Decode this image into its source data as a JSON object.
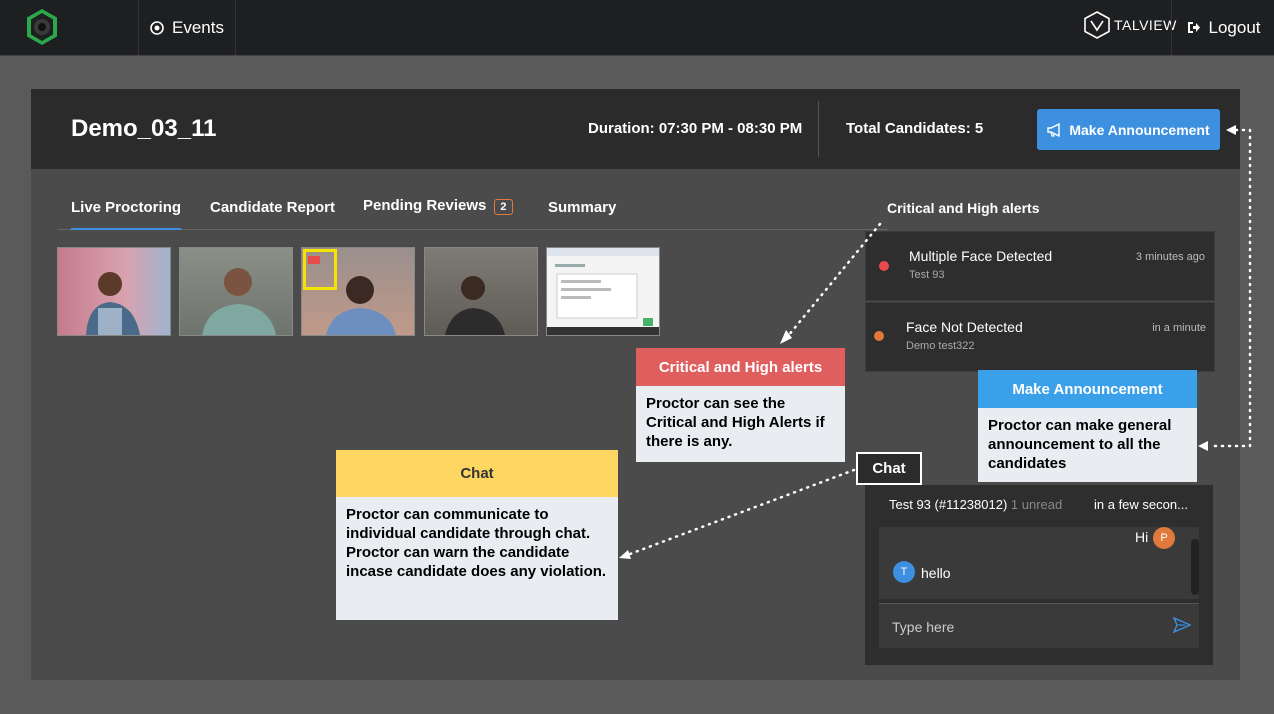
{
  "topbar": {
    "events_label": "Events",
    "brand_label": "TALVIEW",
    "logout_label": "Logout"
  },
  "header": {
    "title": "Demo_03_11",
    "duration": "Duration: 07:30 PM - 08:30 PM",
    "total_candidates": "Total Candidates: 5",
    "announce_button": "Make Announcement"
  },
  "tabs": {
    "live": "Live Proctoring",
    "report": "Candidate Report",
    "pending": "Pending Reviews",
    "pending_count": "2",
    "summary": "Summary"
  },
  "alerts": {
    "title": "Critical and High alerts",
    "items": [
      {
        "title": "Multiple Face Detected",
        "candidate": "Test 93",
        "time": "3 minutes ago",
        "level_color": "#e84b4b"
      },
      {
        "title": "Face Not Detected",
        "candidate": "Demo test322",
        "time": "in a minute",
        "level_color": "#e07a3c"
      }
    ]
  },
  "chat": {
    "candidate": "Test 93 (#11238012)",
    "unread": "1 unread",
    "time": "in a few secon...",
    "messages": [
      {
        "from": "P",
        "text": "Hi"
      },
      {
        "from": "T",
        "text": "hello"
      }
    ],
    "placeholder": "Type here"
  },
  "callouts": {
    "alerts": {
      "title": "Critical and High alerts",
      "body": "Proctor can see the Critical and High Alerts if there is any."
    },
    "announce": {
      "title": "Make Announcement",
      "body": "Proctor can make general announcement to all the candidates"
    },
    "chat_tag": "Chat",
    "chat": {
      "title": "Chat",
      "body": "Proctor can communicate to individual candidate through chat. Proctor can warn the candidate incase candidate does any violation."
    }
  },
  "colors": {
    "accent": "#3d8fe0",
    "critical": "#e84b4b",
    "high": "#e07a3c",
    "alerts_callout": "#df5e5e",
    "announce_callout": "#3aa0ea",
    "chat_callout": "#fdd762"
  }
}
